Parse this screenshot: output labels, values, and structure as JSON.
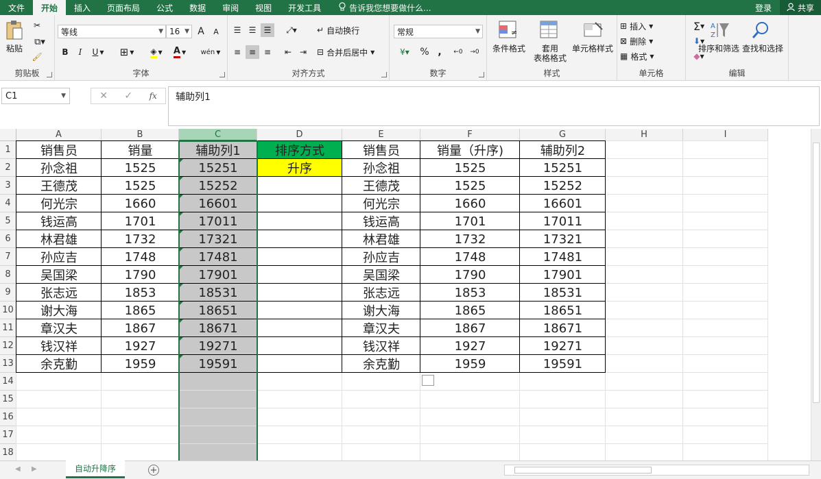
{
  "tabs": [
    "文件",
    "开始",
    "插入",
    "页面布局",
    "公式",
    "数据",
    "审阅",
    "视图",
    "开发工具"
  ],
  "active_tab": 1,
  "tell_me": "告诉我您想要做什么...",
  "login": "登录",
  "share": "共享",
  "ribbon": {
    "clipboard": {
      "paste": "粘贴",
      "label": "剪贴板"
    },
    "font": {
      "name": "等线",
      "size": "16",
      "label": "字体",
      "bold": "B",
      "italic": "I",
      "underline": "U",
      "grow": "A",
      "shrink": "A",
      "phonetic": "wén"
    },
    "alignment": {
      "wrap": "自动换行",
      "merge": "合并后居中",
      "label": "对齐方式"
    },
    "number": {
      "format": "常规",
      "percent": "%",
      "comma": ",",
      "label": "数字"
    },
    "styles": {
      "conditional": "条件格式",
      "table_format": "套用\n表格格式",
      "cell_styles": "单元格样式",
      "label": "样式"
    },
    "cells": {
      "insert": "插入",
      "delete": "删除",
      "format": "格式",
      "label": "单元格"
    },
    "editing": {
      "sort_filter": "排序和筛选",
      "find_select": "查找和选择",
      "label": "编辑"
    }
  },
  "namebox": "C1",
  "formula": "辅助列1",
  "columns": [
    "A",
    "B",
    "C",
    "D",
    "E",
    "F",
    "G",
    "H",
    "I"
  ],
  "selected_column": "C",
  "rows": [
    "1",
    "2",
    "3",
    "4",
    "5",
    "6",
    "7",
    "8",
    "9",
    "10",
    "11",
    "12",
    "13",
    "14",
    "15",
    "16",
    "17",
    "18"
  ],
  "table": {
    "header": [
      "销售员",
      "销量",
      "辅助列1",
      "排序方式",
      "销售员",
      "销量（升序)",
      "辅助列2"
    ],
    "sort_mode": "升序",
    "data": [
      [
        "孙念祖",
        "1525",
        "15251",
        "孙念祖",
        "1525",
        "15251"
      ],
      [
        "王德茂",
        "1525",
        "15252",
        "王德茂",
        "1525",
        "15252"
      ],
      [
        "何光宗",
        "1660",
        "16601",
        "何光宗",
        "1660",
        "16601"
      ],
      [
        "钱运高",
        "1701",
        "17011",
        "钱运高",
        "1701",
        "17011"
      ],
      [
        "林君雄",
        "1732",
        "17321",
        "林君雄",
        "1732",
        "17321"
      ],
      [
        "孙应吉",
        "1748",
        "17481",
        "孙应吉",
        "1748",
        "17481"
      ],
      [
        "吴国梁",
        "1790",
        "17901",
        "吴国梁",
        "1790",
        "17901"
      ],
      [
        "张志远",
        "1853",
        "18531",
        "张志远",
        "1853",
        "18531"
      ],
      [
        "谢大海",
        "1865",
        "18651",
        "谢大海",
        "1865",
        "18651"
      ],
      [
        "章汉夫",
        "1867",
        "18671",
        "章汉夫",
        "1867",
        "18671"
      ],
      [
        "钱汉祥",
        "1927",
        "19271",
        "钱汉祥",
        "1927",
        "19271"
      ],
      [
        "余克勤",
        "1959",
        "19591",
        "余克勤",
        "1959",
        "19591"
      ]
    ]
  },
  "colors": {
    "green": "#217346",
    "header_fill": "#00b050",
    "sort_fill": "#ffff00",
    "selected_fill": "#c8c8c8"
  },
  "sheet_tab": "自动升降序"
}
